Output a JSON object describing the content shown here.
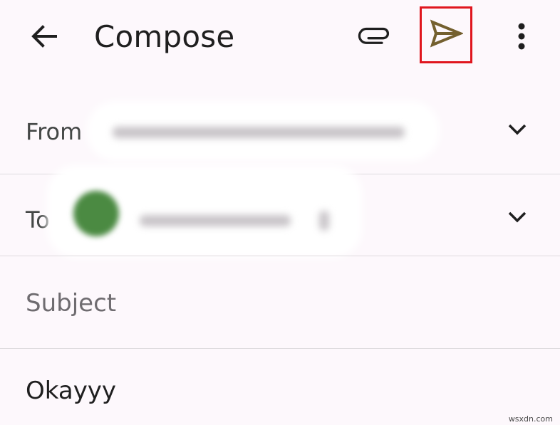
{
  "appbar": {
    "title": "Compose",
    "back_icon": "arrow-back-icon",
    "attach_icon": "paperclip-icon",
    "send_icon": "send-icon",
    "more_icon": "more-vert-icon"
  },
  "from": {
    "label": "From"
  },
  "to": {
    "label": "To"
  },
  "subject": {
    "placeholder": "Subject"
  },
  "body": {
    "text": "Okayyy"
  },
  "watermark": "wsxdn.com",
  "colors": {
    "highlight_border": "#e0161e",
    "send_icon": "#74602f",
    "avatar": "#4b8a42",
    "background": "#fdf8fc"
  }
}
